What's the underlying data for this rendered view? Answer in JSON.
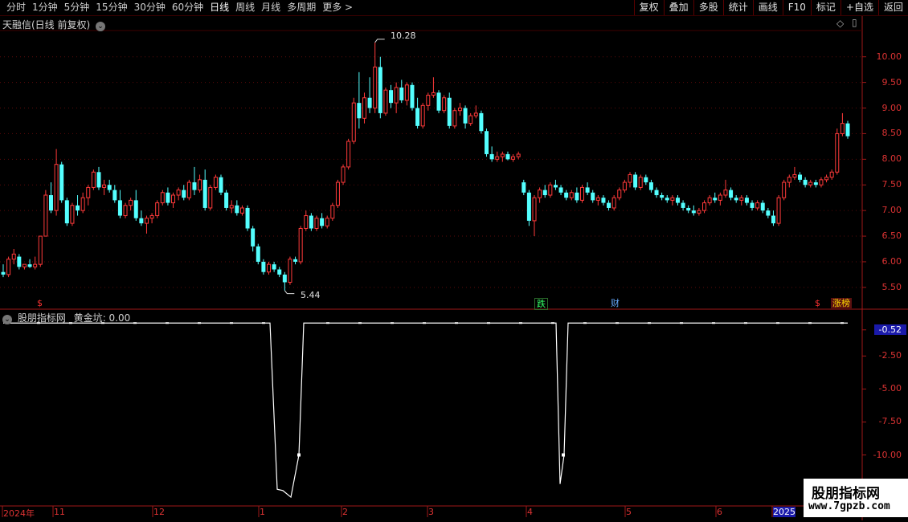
{
  "toolbar": {
    "left": [
      "分时",
      "1分钟",
      "5分钟",
      "15分钟",
      "30分钟",
      "60分钟",
      "日线",
      "周线",
      "月线",
      "多周期",
      "更多 >"
    ],
    "active_index": 6,
    "right": [
      "复权",
      "叠加",
      "多股",
      "统计",
      "画线",
      "F10",
      "标记",
      "+自选",
      "返回"
    ]
  },
  "main_panel": {
    "title": "天融信(日线 前复权)",
    "high_label": "10.28",
    "low_label": "5.44",
    "price_axis": [
      "10.00",
      "9.50",
      "9.00",
      "8.50",
      "8.00",
      "7.50",
      "7.00",
      "6.50",
      "6.00",
      "5.50"
    ],
    "tags": [
      {
        "text": "$",
        "color": "#ff3333"
      },
      {
        "text": "跌",
        "color": "#33ff66"
      },
      {
        "text": "财",
        "color": "#66aaff"
      },
      {
        "text": "$",
        "color": "#ff3333"
      },
      {
        "text": "涨榜",
        "color": "#ffdd00"
      }
    ]
  },
  "indicator_panel": {
    "title": "股朋指标网",
    "series_name": "黄金坑",
    "current_value": "0.00",
    "axis": [
      "-0.52",
      "-2.50",
      "-5.00",
      "-7.50",
      "-10.00"
    ]
  },
  "date_axis": [
    "2024年",
    "11",
    "12",
    "1",
    "2",
    "3",
    "4",
    "5",
    "6",
    "2025"
  ],
  "watermark": {
    "line1": "股朋指标网",
    "line2": "www.7gpzb.com"
  },
  "chart_data": {
    "type": "candlestick",
    "price_ylim": [
      5.2,
      10.45
    ],
    "price_high": 10.28,
    "price_low": 5.44,
    "indicator_ylim": [
      -13.5,
      0.5
    ],
    "indicator_last": 0.0,
    "candles": [
      [
        5.8,
        5.95,
        5.7,
        5.75
      ],
      [
        5.75,
        6.1,
        5.7,
        6.05
      ],
      [
        6.05,
        6.25,
        5.95,
        6.15
      ],
      [
        6.1,
        6.15,
        5.85,
        5.9
      ],
      [
        5.9,
        5.95,
        5.85,
        5.95
      ],
      [
        5.95,
        6.05,
        5.88,
        5.9
      ],
      [
        5.9,
        6.1,
        5.85,
        5.95
      ],
      [
        5.95,
        6.5,
        5.9,
        6.5
      ],
      [
        6.5,
        7.4,
        6.5,
        7.3
      ],
      [
        7.3,
        7.55,
        6.95,
        7.0
      ],
      [
        7.0,
        8.2,
        6.9,
        7.9
      ],
      [
        7.9,
        7.95,
        7.15,
        7.2
      ],
      [
        7.2,
        7.25,
        6.7,
        6.75
      ],
      [
        6.75,
        7.15,
        6.7,
        7.1
      ],
      [
        7.1,
        7.3,
        6.9,
        7.0
      ],
      [
        7.0,
        7.35,
        6.95,
        7.25
      ],
      [
        7.25,
        7.5,
        7.1,
        7.45
      ],
      [
        7.45,
        7.8,
        7.4,
        7.75
      ],
      [
        7.75,
        7.85,
        7.4,
        7.45
      ],
      [
        7.45,
        7.6,
        7.3,
        7.5
      ],
      [
        7.5,
        7.6,
        7.35,
        7.4
      ],
      [
        7.4,
        7.5,
        7.15,
        7.2
      ],
      [
        7.2,
        7.4,
        6.85,
        6.9
      ],
      [
        6.9,
        7.15,
        6.85,
        7.1
      ],
      [
        7.1,
        7.25,
        7.0,
        7.2
      ],
      [
        7.2,
        7.4,
        6.8,
        6.85
      ],
      [
        6.85,
        7.0,
        6.7,
        6.75
      ],
      [
        6.75,
        6.9,
        6.55,
        6.85
      ],
      [
        6.85,
        6.95,
        6.75,
        6.9
      ],
      [
        6.9,
        7.2,
        6.85,
        7.15
      ],
      [
        7.15,
        7.4,
        7.1,
        7.35
      ],
      [
        7.35,
        7.45,
        7.1,
        7.15
      ],
      [
        7.15,
        7.35,
        7.05,
        7.3
      ],
      [
        7.3,
        7.45,
        7.2,
        7.4
      ],
      [
        7.4,
        7.5,
        7.2,
        7.25
      ],
      [
        7.25,
        7.6,
        7.2,
        7.55
      ],
      [
        7.55,
        7.85,
        7.3,
        7.4
      ],
      [
        7.4,
        7.7,
        7.35,
        7.6
      ],
      [
        7.6,
        7.8,
        7.0,
        7.05
      ],
      [
        7.05,
        7.5,
        7.0,
        7.45
      ],
      [
        7.45,
        7.7,
        7.4,
        7.65
      ],
      [
        7.65,
        7.7,
        7.3,
        7.35
      ],
      [
        7.35,
        7.4,
        7.0,
        7.05
      ],
      [
        7.05,
        7.2,
        6.95,
        7.1
      ],
      [
        7.1,
        7.2,
        6.9,
        6.95
      ],
      [
        6.95,
        7.1,
        6.9,
        7.05
      ],
      [
        7.05,
        7.1,
        6.6,
        6.65
      ],
      [
        6.65,
        6.7,
        6.2,
        6.3
      ],
      [
        6.3,
        6.35,
        5.95,
        6.0
      ],
      [
        6.0,
        6.05,
        5.75,
        5.8
      ],
      [
        5.8,
        6.0,
        5.75,
        5.95
      ],
      [
        5.95,
        6.0,
        5.8,
        5.85
      ],
      [
        5.85,
        5.9,
        5.7,
        5.75
      ],
      [
        5.75,
        5.8,
        5.44,
        5.6
      ],
      [
        5.6,
        6.1,
        5.55,
        6.05
      ],
      [
        6.05,
        6.1,
        5.95,
        6.0
      ],
      [
        6.0,
        6.7,
        5.95,
        6.65
      ],
      [
        6.65,
        7.0,
        6.6,
        6.9
      ],
      [
        6.9,
        6.95,
        6.6,
        6.65
      ],
      [
        6.65,
        6.9,
        6.6,
        6.85
      ],
      [
        6.85,
        6.95,
        6.65,
        6.7
      ],
      [
        6.7,
        6.9,
        6.65,
        6.85
      ],
      [
        6.85,
        7.15,
        6.8,
        7.1
      ],
      [
        7.1,
        7.6,
        7.05,
        7.55
      ],
      [
        7.55,
        7.9,
        7.5,
        7.85
      ],
      [
        7.85,
        8.4,
        7.8,
        8.35
      ],
      [
        8.35,
        9.2,
        8.3,
        9.1
      ],
      [
        9.1,
        9.7,
        8.6,
        8.8
      ],
      [
        8.8,
        9.3,
        8.7,
        9.2
      ],
      [
        9.2,
        9.6,
        8.9,
        9.0
      ],
      [
        9.0,
        10.28,
        8.9,
        9.8
      ],
      [
        9.8,
        10.0,
        8.8,
        8.9
      ],
      [
        8.9,
        9.4,
        8.85,
        9.35
      ],
      [
        9.35,
        9.45,
        9.0,
        9.1
      ],
      [
        9.1,
        9.5,
        8.9,
        9.4
      ],
      [
        9.4,
        9.55,
        9.1,
        9.15
      ],
      [
        9.15,
        9.5,
        9.05,
        9.45
      ],
      [
        9.45,
        9.5,
        8.95,
        9.0
      ],
      [
        9.0,
        9.2,
        8.6,
        8.65
      ],
      [
        8.65,
        9.1,
        8.6,
        9.05
      ],
      [
        9.05,
        9.3,
        8.95,
        9.25
      ],
      [
        9.25,
        9.6,
        9.2,
        9.3
      ],
      [
        9.3,
        9.35,
        8.9,
        8.95
      ],
      [
        8.95,
        9.25,
        8.9,
        9.2
      ],
      [
        9.2,
        9.3,
        8.6,
        8.65
      ],
      [
        8.65,
        9.0,
        8.6,
        8.95
      ],
      [
        8.95,
        9.1,
        8.85,
        9.0
      ],
      [
        9.0,
        9.05,
        8.6,
        8.7
      ],
      [
        8.7,
        8.9,
        8.65,
        8.85
      ],
      [
        8.85,
        9.05,
        8.8,
        8.9
      ],
      [
        8.9,
        8.95,
        8.5,
        8.55
      ],
      [
        8.55,
        8.6,
        8.05,
        8.1
      ],
      [
        8.1,
        8.25,
        7.95,
        8.0
      ],
      [
        8.0,
        8.15,
        7.95,
        8.05
      ],
      [
        8.05,
        8.15,
        7.95,
        8.1
      ],
      [
        8.1,
        8.15,
        7.98,
        8.0
      ],
      [
        8.0,
        8.1,
        7.95,
        8.05
      ],
      [
        8.05,
        8.15,
        8.0,
        8.1
      ],
      [
        7.55,
        7.6,
        7.3,
        7.35
      ],
      [
        7.35,
        7.4,
        6.7,
        6.8
      ],
      [
        6.8,
        7.3,
        6.5,
        7.25
      ],
      [
        7.25,
        7.45,
        7.15,
        7.4
      ],
      [
        7.4,
        7.5,
        7.25,
        7.3
      ],
      [
        7.3,
        7.55,
        7.25,
        7.5
      ],
      [
        7.5,
        7.6,
        7.4,
        7.45
      ],
      [
        7.45,
        7.5,
        7.3,
        7.35
      ],
      [
        7.35,
        7.4,
        7.2,
        7.25
      ],
      [
        7.25,
        7.4,
        7.2,
        7.35
      ],
      [
        7.35,
        7.45,
        7.15,
        7.2
      ],
      [
        7.2,
        7.5,
        7.15,
        7.45
      ],
      [
        7.45,
        7.55,
        7.3,
        7.35
      ],
      [
        7.35,
        7.4,
        7.15,
        7.2
      ],
      [
        7.2,
        7.3,
        7.1,
        7.25
      ],
      [
        7.25,
        7.3,
        7.1,
        7.15
      ],
      [
        7.15,
        7.2,
        7.0,
        7.05
      ],
      [
        7.05,
        7.3,
        7.0,
        7.25
      ],
      [
        7.25,
        7.45,
        7.2,
        7.4
      ],
      [
        7.4,
        7.6,
        7.35,
        7.55
      ],
      [
        7.55,
        7.75,
        7.45,
        7.7
      ],
      [
        7.7,
        7.75,
        7.4,
        7.45
      ],
      [
        7.45,
        7.7,
        7.4,
        7.65
      ],
      [
        7.65,
        7.7,
        7.5,
        7.55
      ],
      [
        7.55,
        7.6,
        7.35,
        7.4
      ],
      [
        7.4,
        7.45,
        7.25,
        7.3
      ],
      [
        7.3,
        7.35,
        7.2,
        7.25
      ],
      [
        7.25,
        7.3,
        7.15,
        7.2
      ],
      [
        7.2,
        7.3,
        7.1,
        7.25
      ],
      [
        7.25,
        7.3,
        7.1,
        7.15
      ],
      [
        7.15,
        7.2,
        7.0,
        7.05
      ],
      [
        7.05,
        7.1,
        6.95,
        7.0
      ],
      [
        7.0,
        7.1,
        6.9,
        6.95
      ],
      [
        6.95,
        7.05,
        6.9,
        7.0
      ],
      [
        7.0,
        7.2,
        6.95,
        7.15
      ],
      [
        7.15,
        7.3,
        7.1,
        7.25
      ],
      [
        7.25,
        7.35,
        7.15,
        7.2
      ],
      [
        7.2,
        7.35,
        7.1,
        7.3
      ],
      [
        7.3,
        7.6,
        7.25,
        7.4
      ],
      [
        7.4,
        7.45,
        7.2,
        7.25
      ],
      [
        7.25,
        7.3,
        7.15,
        7.2
      ],
      [
        7.2,
        7.3,
        7.1,
        7.25
      ],
      [
        7.25,
        7.3,
        7.1,
        7.15
      ],
      [
        7.15,
        7.2,
        7.0,
        7.05
      ],
      [
        7.05,
        7.2,
        7.0,
        7.15
      ],
      [
        7.15,
        7.2,
        6.95,
        7.0
      ],
      [
        7.0,
        7.05,
        6.85,
        6.9
      ],
      [
        6.9,
        7.0,
        6.7,
        6.75
      ],
      [
        6.75,
        7.3,
        6.7,
        7.25
      ],
      [
        7.25,
        7.6,
        7.2,
        7.55
      ],
      [
        7.55,
        7.7,
        7.45,
        7.65
      ],
      [
        7.65,
        7.85,
        7.6,
        7.7
      ],
      [
        7.7,
        7.75,
        7.55,
        7.6
      ],
      [
        7.6,
        7.65,
        7.45,
        7.5
      ],
      [
        7.5,
        7.6,
        7.45,
        7.55
      ],
      [
        7.55,
        7.6,
        7.45,
        7.5
      ],
      [
        7.5,
        7.65,
        7.45,
        7.6
      ],
      [
        7.6,
        7.7,
        7.55,
        7.65
      ],
      [
        7.65,
        7.8,
        7.6,
        7.75
      ],
      [
        7.75,
        8.6,
        7.7,
        8.5
      ],
      [
        8.5,
        8.9,
        8.45,
        8.7
      ],
      [
        8.7,
        8.75,
        8.4,
        8.45
      ]
    ],
    "indicator": [
      0,
      0,
      0,
      0,
      0,
      0,
      0,
      0,
      0,
      0,
      0,
      0,
      0,
      0,
      0,
      0,
      0,
      0,
      0,
      0,
      0,
      0,
      0,
      0,
      0,
      0,
      0,
      0,
      0,
      0,
      0,
      0,
      0,
      0,
      0,
      0,
      0,
      0,
      0,
      0,
      0,
      0,
      0,
      0,
      0,
      0,
      0,
      0,
      0,
      0,
      0,
      0,
      0,
      0,
      0,
      0,
      0,
      0,
      0,
      0,
      0,
      0,
      0,
      0,
      0,
      0,
      0,
      0,
      0,
      0,
      0,
      0,
      0,
      0,
      0,
      0,
      0,
      0,
      0,
      0,
      0,
      0,
      0,
      0,
      0,
      0,
      0,
      0,
      0,
      0,
      0,
      0,
      0,
      0,
      0,
      0,
      0,
      0,
      0,
      0,
      0,
      0,
      0,
      0,
      0,
      0,
      0,
      0,
      0,
      0,
      0,
      0,
      0,
      0,
      0,
      0,
      0,
      0,
      0,
      0,
      0,
      0,
      0,
      0,
      0,
      0,
      0,
      0,
      0,
      0,
      0,
      0,
      0,
      0,
      0,
      0,
      0,
      0,
      0,
      0,
      0,
      0,
      0,
      0,
      0,
      0,
      0,
      0,
      0,
      0,
      0,
      0,
      0,
      0,
      0,
      0,
      0
    ],
    "indicator_dips": [
      {
        "series": "黄金坑",
        "x_range": "2025-01",
        "min_value": -13.2,
        "marker_value": -10.0
      },
      {
        "series": "黄金坑",
        "x_range": "2025-04",
        "min_value": -12.2,
        "marker_value": -10.0
      }
    ]
  }
}
